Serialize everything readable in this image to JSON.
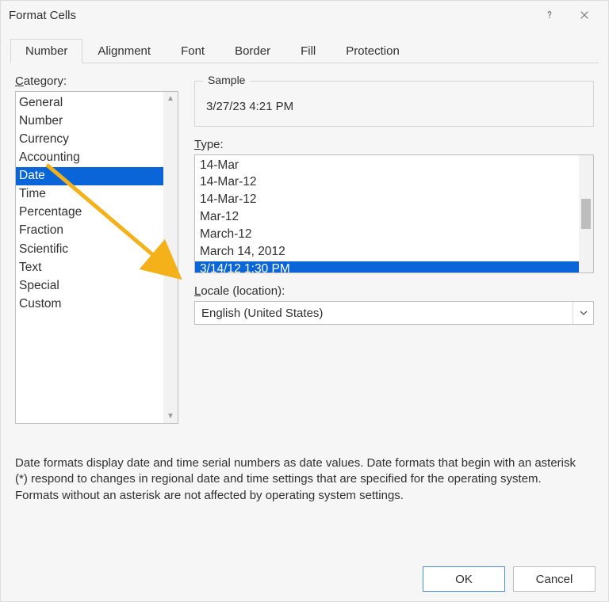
{
  "titlebar": {
    "title": "Format Cells"
  },
  "tabs": [
    "Number",
    "Alignment",
    "Font",
    "Border",
    "Fill",
    "Protection"
  ],
  "active_tab_index": 0,
  "category": {
    "label": "Category:",
    "items": [
      "General",
      "Number",
      "Currency",
      "Accounting",
      "Date",
      "Time",
      "Percentage",
      "Fraction",
      "Scientific",
      "Text",
      "Special",
      "Custom"
    ],
    "selected_index": 4
  },
  "sample": {
    "legend": "Sample",
    "value": "3/27/23 4:21 PM"
  },
  "type": {
    "label": "Type:",
    "items": [
      "14-Mar",
      "14-Mar-12",
      "14-Mar-12",
      "Mar-12",
      "March-12",
      "March 14, 2012",
      "3/14/12 1:30 PM"
    ],
    "selected_index": 6
  },
  "locale": {
    "label": "Locale (location):",
    "value": "English (United States)"
  },
  "description": "Date formats display date and time serial numbers as date values.  Date formats that begin with an asterisk (*) respond to changes in regional date and time settings that are specified for the operating system. Formats without an asterisk are not affected by operating system settings.",
  "buttons": {
    "ok": "OK",
    "cancel": "Cancel"
  }
}
